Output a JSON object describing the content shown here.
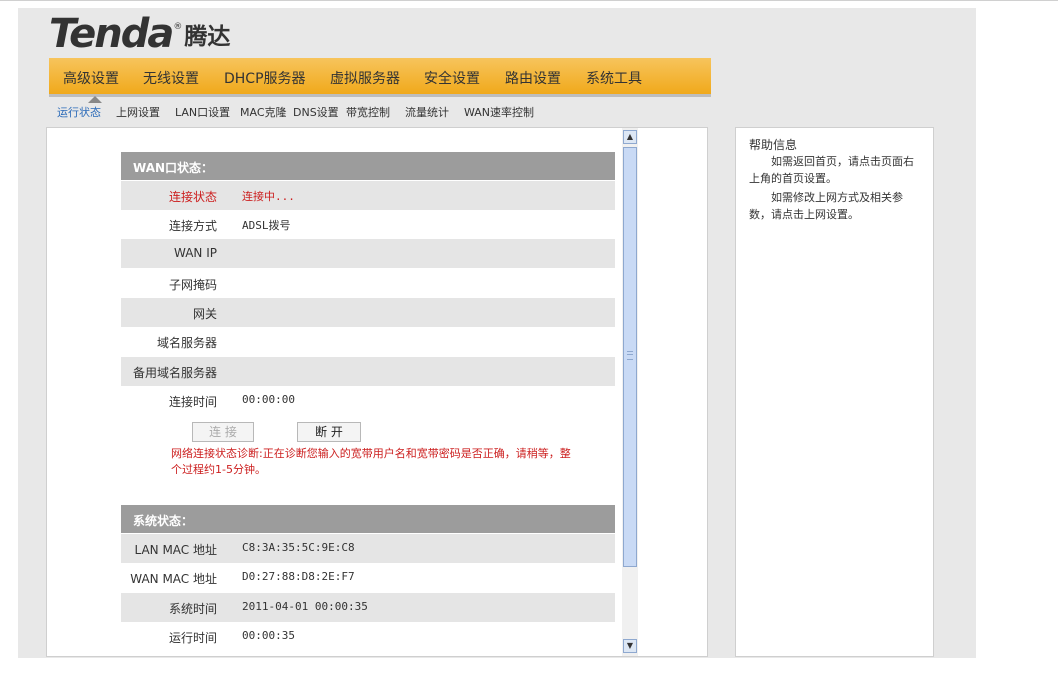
{
  "logo": {
    "brand": "Tenda",
    "reg": "®",
    "cn": "腾达"
  },
  "main_nav": [
    "高级设置",
    "无线设置",
    "DHCP服务器",
    "虚拟服务器",
    "安全设置",
    "路由设置",
    "系统工具"
  ],
  "sub_nav": [
    "运行状态",
    "上网设置",
    "LAN口设置",
    "MAC克隆",
    "DNS设置",
    "带宽控制",
    "流量统计",
    "WAN速率控制"
  ],
  "sub_nav_active": "运行状态",
  "wan": {
    "title": "WAN口状态：",
    "rows": [
      {
        "label": "连接状态",
        "value": "连接中..."
      },
      {
        "label": "连接方式",
        "value": "ADSL拨号"
      },
      {
        "label": "WAN IP",
        "value": ""
      },
      {
        "label": "子网掩码",
        "value": ""
      },
      {
        "label": "网关",
        "value": ""
      },
      {
        "label": "域名服务器",
        "value": ""
      },
      {
        "label": "备用域名服务器",
        "value": ""
      },
      {
        "label": "连接时间",
        "value": "00:00:00"
      }
    ],
    "connect_button": "连 接",
    "disconnect_button": "断 开",
    "diagnosis": "网络连接状态诊断:正在诊断您输入的宽带用户名和宽带密码是否正确，请稍等，整个过程约1-5分钟。"
  },
  "system": {
    "title": "系统状态：",
    "rows": [
      {
        "label": "LAN MAC 地址",
        "value": "C8:3A:35:5C:9E:C8"
      },
      {
        "label": "WAN MAC 地址",
        "value": "D0:27:88:D8:2E:F7"
      },
      {
        "label": "系统时间",
        "value": "2011-04-01 00:00:35"
      },
      {
        "label": "运行时间",
        "value": "00:00:35"
      }
    ]
  },
  "help": {
    "title": "帮助信息",
    "p1": "如需返回首页，请点击页面右上角的首页设置。",
    "p2": "如需修改上网方式及相关参数，请点击上网设置。"
  },
  "icons": {
    "scroll_up": "▲",
    "scroll_down": "▼"
  },
  "colors": {
    "nav_bar": "#f0a91b",
    "active_tab": "#2a6ab8",
    "alert_text": "#cc1e1e",
    "section_header": "#9c9c9c"
  }
}
